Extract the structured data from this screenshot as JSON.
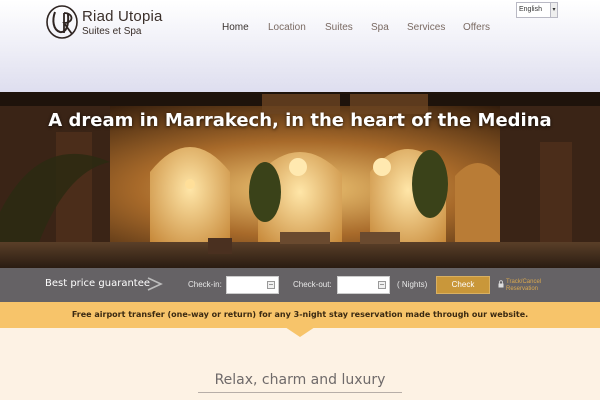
{
  "brand": {
    "name": "Riad Utopia",
    "tagline": "Suites et Spa",
    "monogram": "UR"
  },
  "nav": {
    "items": [
      {
        "label": "Home",
        "active": true
      },
      {
        "label": "Location"
      },
      {
        "label": "Suites"
      },
      {
        "label": "Spa"
      },
      {
        "label": "Services"
      },
      {
        "label": "Offers"
      }
    ]
  },
  "language": {
    "selected": "English"
  },
  "hero": {
    "title": "A dream in Marrakech, in the heart of the Medina"
  },
  "booking": {
    "label": "Best price guarantee",
    "checkin_label": "Check-in:",
    "checkout_label": "Check-out:",
    "nights_label": "( Nights)",
    "check_button": "Check",
    "track_link_line1": "Track/Cancel",
    "track_link_line2": "Reservation"
  },
  "notice": {
    "text": "Free airport transfer (one-way or return) for any 3-night stay reservation made through our website."
  },
  "section": {
    "title": "Relax, charm and luxury"
  },
  "colors": {
    "accent": "#f7c46a",
    "button": "#c9973a",
    "booking_bar": "#5f5c5f",
    "section_bg": "#fdf2e4"
  }
}
